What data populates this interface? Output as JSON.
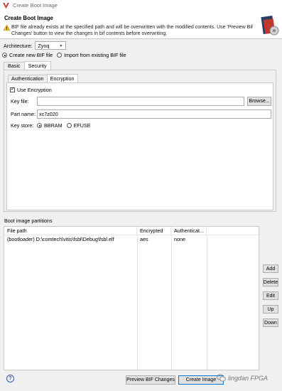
{
  "window": {
    "title": "Create Boot Image"
  },
  "header": {
    "title": "Create Boot Image",
    "warning_line1": "BIF file already exists at the specified path and will be overwritten with the modified contents. Use 'Preview Bif",
    "warning_line2": "Changes' button to view the changes in bif contents before overwriting."
  },
  "architecture": {
    "label": "Architecture:",
    "value": "Zynq"
  },
  "bif_mode": {
    "create_label": "Create new BIF file",
    "import_label": "Import from existing BIF file",
    "selected": "create"
  },
  "tabs": [
    {
      "label": "Basic"
    },
    {
      "label": "Security"
    }
  ],
  "security": {
    "subtabs": [
      {
        "label": "Authentication"
      },
      {
        "label": "Encryption"
      }
    ],
    "use_encryption_label": "Use Encryption",
    "use_encryption_checked": true,
    "key_file_label": "Key file:",
    "key_file_value": "",
    "browse_label": "Browse...",
    "part_name_label": "Part name:",
    "part_name_value": "xc7z020",
    "key_store_label": "Key store:",
    "key_store_options": [
      {
        "label": "BBRAM"
      },
      {
        "label": "EFUSE"
      }
    ],
    "key_store_selected": "BBRAM"
  },
  "partitions": {
    "label": "Boot image partitions",
    "columns": [
      "File path",
      "Encrypted",
      "Authenticat..."
    ],
    "rows": [
      {
        "file": "(bootloader) D:\\comtech\\vitis\\fsbl\\Debug\\fsbl.elf",
        "encrypted": "aes",
        "auth": "none"
      }
    ],
    "buttons": {
      "add": "Add",
      "delete": "Delete",
      "edit": "Edit",
      "up": "Up",
      "down": "Down"
    }
  },
  "footer": {
    "help": "?",
    "preview_label": "Preview BIF Changes",
    "create_label": "Create Image",
    "watermark": "lingdan FPGA"
  },
  "colors": {
    "accent_red": "#c0392b",
    "warn_yellow": "#f4c430",
    "help_blue": "#2a5ba8"
  }
}
